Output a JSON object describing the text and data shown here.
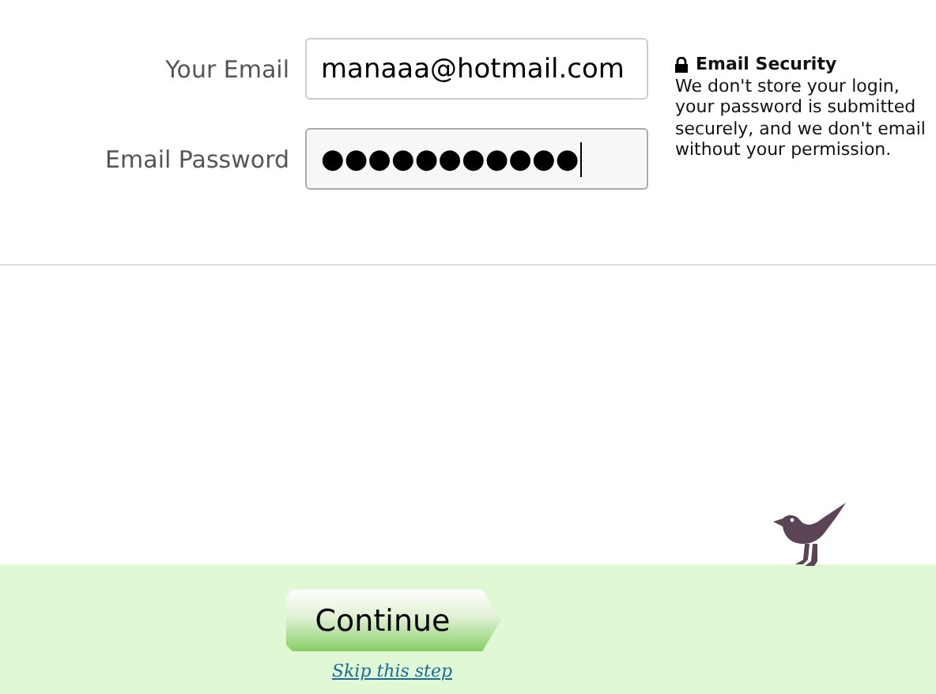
{
  "fields": [
    {
      "label": "Your Email",
      "value": "manaaa@hotmail.com",
      "focused": false
    },
    {
      "label": "Email Password",
      "value": "●●●●●●●●●●●",
      "focused": true
    }
  ],
  "security_note": {
    "title": "Email Security",
    "text": "We don't store your login, your password is submitted securely, and we don't email without your permission."
  },
  "footer": {
    "button": "Continue",
    "skip_link": "Skip this step"
  }
}
